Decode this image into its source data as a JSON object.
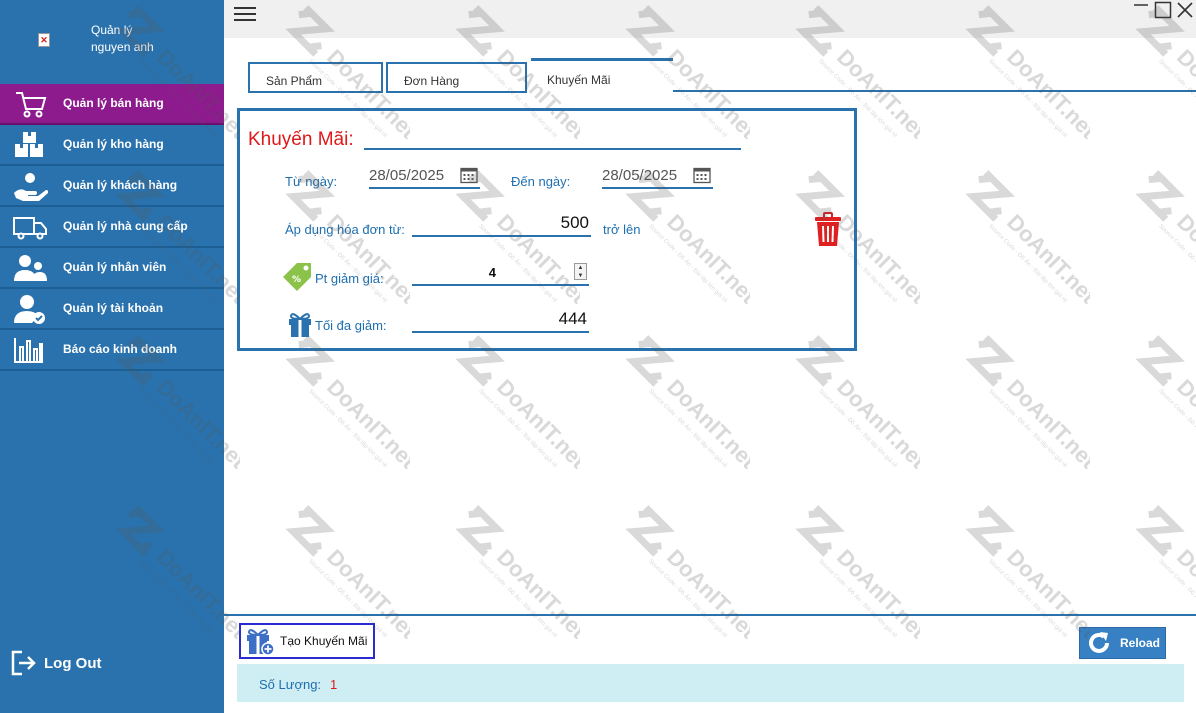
{
  "user": {
    "name": "Quản lý\nnguyen anh",
    "avatar_icon": "broken-image-icon"
  },
  "sidebar": {
    "items": [
      {
        "label": "Quản lý bán hàng",
        "icon": "cart-icon",
        "active": true
      },
      {
        "label": "Quản lý kho hàng",
        "icon": "warehouse-icon",
        "active": false
      },
      {
        "label": "Quản lý khách hàng",
        "icon": "customer-icon",
        "active": false
      },
      {
        "label": "Quản lý nhà cung cấp",
        "icon": "truck-icon",
        "active": false
      },
      {
        "label": "Quản lý nhân viên",
        "icon": "staff-icon",
        "active": false
      },
      {
        "label": "Quản lý tài khoản",
        "icon": "account-icon",
        "active": false
      },
      {
        "label": "Báo cáo kinh doanh",
        "icon": "bar-chart-icon",
        "active": false
      }
    ],
    "logout_label": "Log Out"
  },
  "tabs": [
    {
      "label": "Sản Phẩm",
      "selected": false
    },
    {
      "label": "Đơn Hàng",
      "selected": false
    },
    {
      "label": "Khuyến Mãi",
      "selected": true
    }
  ],
  "promo": {
    "title": "Khuyến Mãi:",
    "from_label": "Từ ngày:",
    "from_date": "28/05/2025",
    "to_label": "Đến ngày:",
    "to_date": "28/05/2025",
    "apply_label": "Áp dụng hóa đơn từ:",
    "apply_value": "500",
    "apply_suffix": "trở lên",
    "discount_label": "Pt giảm giá:",
    "discount_value": "4",
    "max_label": "Tối đa giảm:",
    "max_value": "444"
  },
  "footer": {
    "create_label": "Tạo Khuyến Mãi",
    "reload_label": "Reload",
    "count_label": "Số Lượng:",
    "count_value": "1"
  },
  "watermark": {
    "text": "DoAnIT.net",
    "subtext": "Source Code - Đồ Án - Bài tập lớn giá rẻ"
  },
  "colors": {
    "sidebar": "#2a72ad",
    "active": "#8d1b8e",
    "title": "#e01818",
    "status_bg": "#cfeef3"
  }
}
